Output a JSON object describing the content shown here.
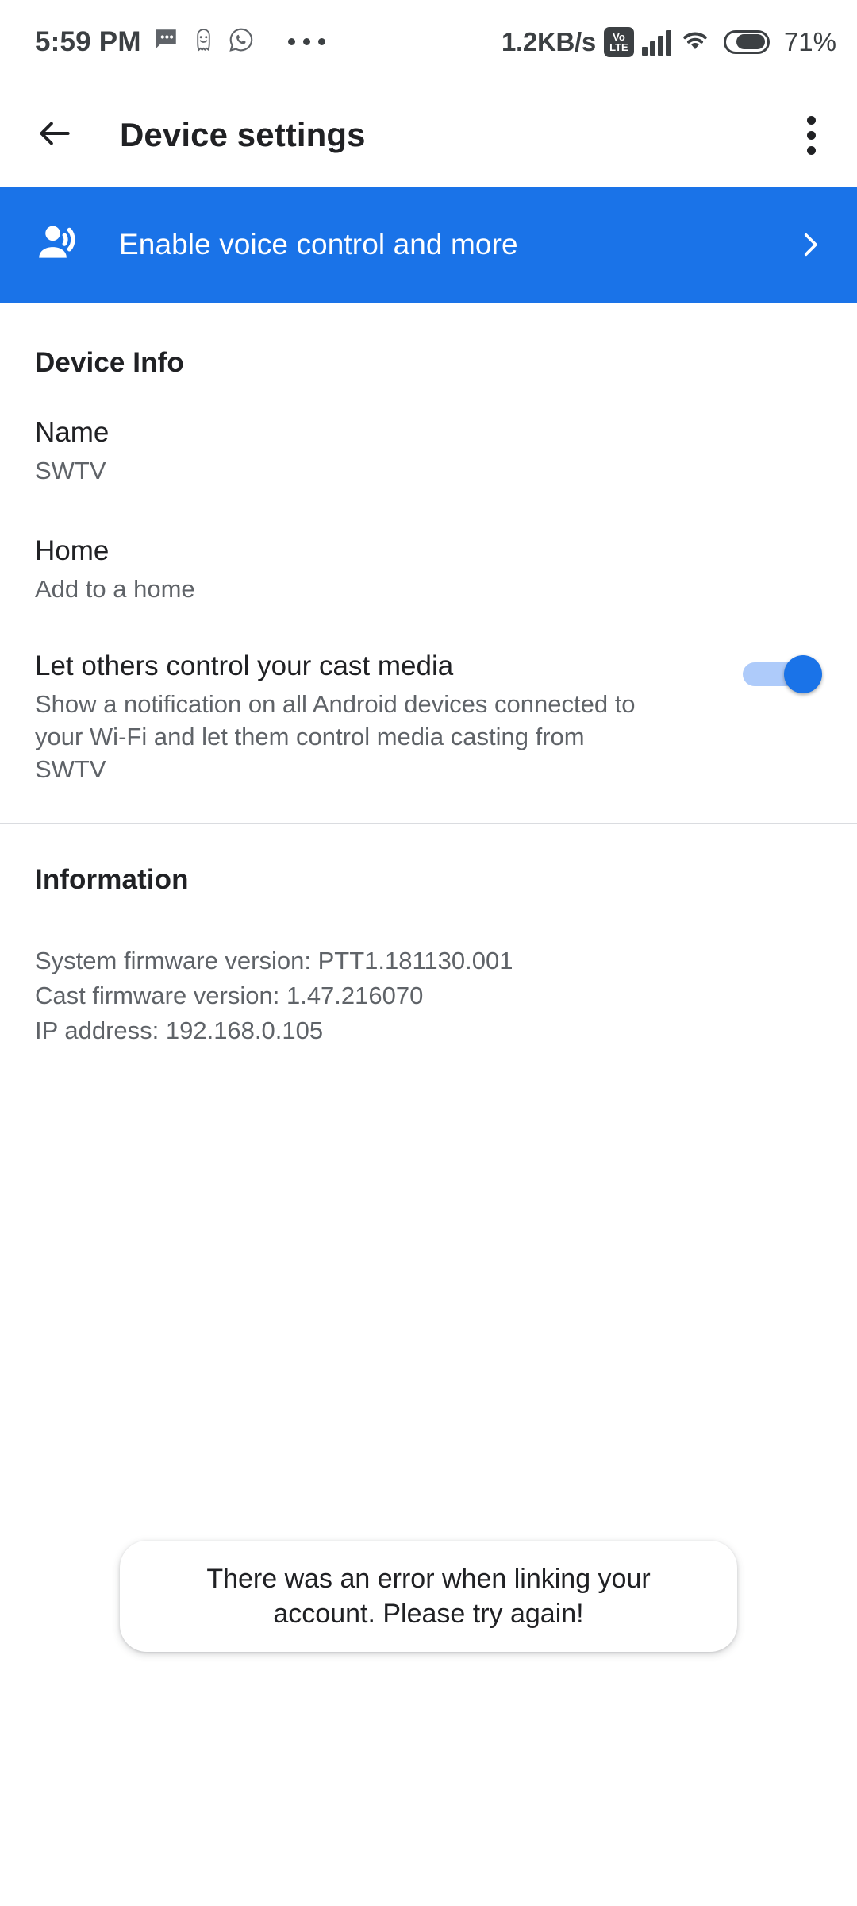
{
  "status_bar": {
    "time": "5:59 PM",
    "notification_icons": [
      "sms-icon",
      "snapchat-ghost-icon",
      "whatsapp-icon"
    ],
    "overflow_dots": "•••",
    "network_speed": "1.2KB/s",
    "volte_top": "Vo",
    "volte_bottom": "LTE",
    "signal_icon": "signal-bars-icon",
    "wifi_icon": "wifi-icon",
    "battery_percent": "71%",
    "battery_level": 71
  },
  "app_bar": {
    "back_icon": "back-arrow-icon",
    "title": "Device settings",
    "overflow_icon": "overflow-menu-icon"
  },
  "banner": {
    "icon": "record-voice-over-icon",
    "label": "Enable voice control and more",
    "chevron_icon": "chevron-right-icon",
    "background_color": "#1a73e8"
  },
  "device_info": {
    "section_title": "Device Info",
    "rows": [
      {
        "title": "Name",
        "subtitle": "SWTV"
      },
      {
        "title": "Home",
        "subtitle": "Add to a home"
      }
    ],
    "cast_toggle": {
      "title": "Let others control your cast media",
      "description": "Show a notification on all Android devices connected to your Wi-Fi and let them control media casting from SWTV",
      "enabled": true,
      "on_color": "#1a73e8",
      "track_color": "#aecbfa"
    }
  },
  "information": {
    "section_title": "Information",
    "lines": [
      "System firmware version: PTT1.181130.001",
      "Cast firmware version: 1.47.216070",
      "IP address: 192.168.0.105"
    ]
  },
  "toast": {
    "message": "There was an error when linking your account. Please try again!"
  }
}
